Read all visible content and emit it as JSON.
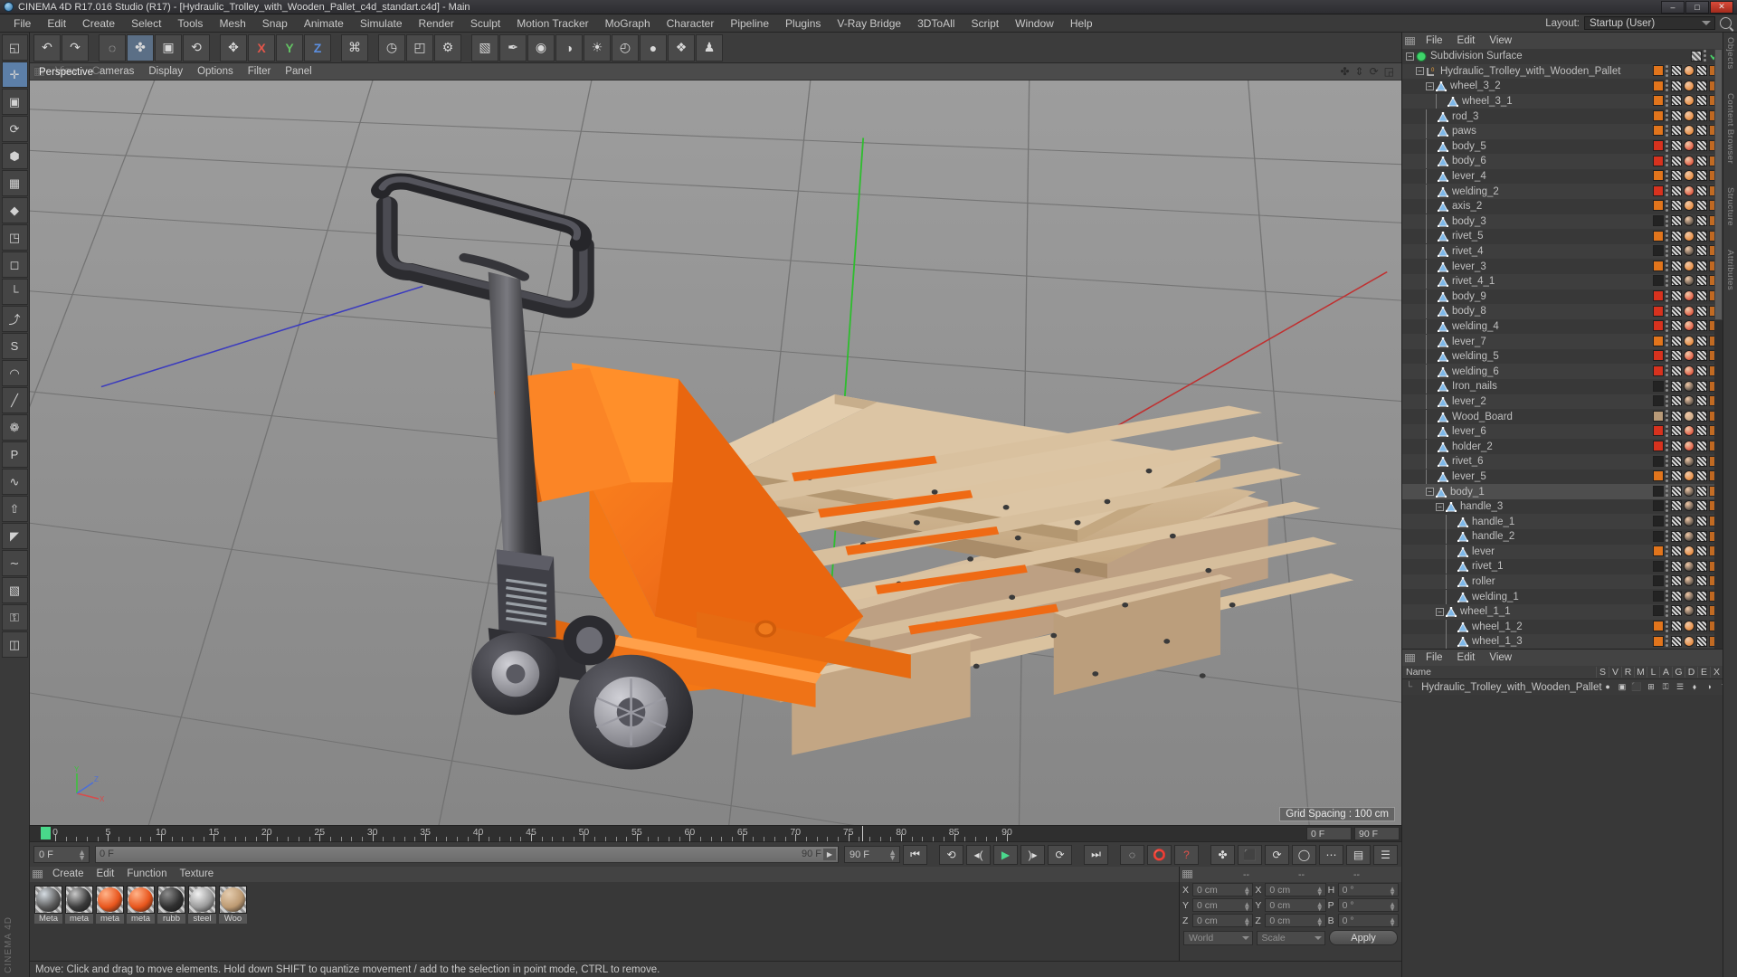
{
  "titlebar": {
    "text": "CINEMA 4D R17.016 Studio (R17) - [Hydraulic_Trolley_with_Wooden_Pallet_c4d_standart.c4d] - Main",
    "minimize": "–",
    "maximize": "□",
    "close": "✕"
  },
  "menubar": {
    "items": [
      "File",
      "Edit",
      "Create",
      "Select",
      "Tools",
      "Mesh",
      "Snap",
      "Animate",
      "Simulate",
      "Render",
      "Sculpt",
      "Motion Tracker",
      "MoGraph",
      "Character",
      "Pipeline",
      "Plugins",
      "V-Ray Bridge",
      "3DToAll",
      "Script",
      "Window",
      "Help"
    ],
    "layout_label": "Layout:",
    "layout_value": "Startup (User)"
  },
  "left_tools": [
    {
      "name": "live-selection-tool",
      "glyph": "◱"
    },
    {
      "name": "move-tool",
      "glyph": "✛"
    },
    {
      "name": "scale-tool",
      "glyph": "▣"
    },
    {
      "name": "rotate-tool",
      "glyph": "⟳"
    },
    {
      "name": "model-mode-tool",
      "glyph": "⬢"
    },
    {
      "name": "texture-mode-tool",
      "glyph": "▦"
    },
    {
      "name": "polygon-mode-tool",
      "glyph": "◆"
    },
    {
      "name": "edge-mode-tool",
      "glyph": "◳"
    },
    {
      "name": "point-mode-tool",
      "glyph": "◻"
    },
    {
      "name": "axis-lock-tool",
      "glyph": "└"
    },
    {
      "name": "enable-axis-tool",
      "glyph": "⤴"
    },
    {
      "name": "enable-snap-tool",
      "glyph": "S"
    },
    {
      "name": "magnet-tool",
      "glyph": "◠"
    },
    {
      "name": "knife-tool",
      "glyph": "╱"
    },
    {
      "name": "brush-tool",
      "glyph": "❁"
    },
    {
      "name": "paint-tool",
      "glyph": "P"
    },
    {
      "name": "smooth-tool",
      "glyph": "∿"
    },
    {
      "name": "extrude-tool",
      "glyph": "⇧"
    },
    {
      "name": "bevel-tool",
      "glyph": "◤"
    },
    {
      "name": "spline-tool",
      "glyph": "∼"
    },
    {
      "name": "uv-tool",
      "glyph": "▧"
    },
    {
      "name": "lock-tool",
      "glyph": "⚿"
    },
    {
      "name": "workplane-tool",
      "glyph": "◫"
    }
  ],
  "toolbar": [
    {
      "name": "undo-button",
      "glyph": "↶",
      "style": "orange"
    },
    {
      "name": "redo-button",
      "glyph": "↷",
      "style": "orange"
    },
    {
      "name": "live-selection-button",
      "glyph": "◌",
      "style": ""
    },
    {
      "name": "move-button",
      "glyph": "✤",
      "style": "on"
    },
    {
      "name": "scale-button",
      "glyph": "▣",
      "style": ""
    },
    {
      "name": "rotate-button",
      "glyph": "⟲",
      "style": ""
    },
    {
      "name": "world-axis-button",
      "glyph": "✥",
      "style": ""
    },
    {
      "name": "x-axis-button",
      "glyph": "X",
      "style": "red axis"
    },
    {
      "name": "y-axis-button",
      "glyph": "Y",
      "style": "green axis"
    },
    {
      "name": "z-axis-button",
      "glyph": "Z",
      "style": "blue axis"
    },
    {
      "name": "world-object-button",
      "glyph": "⌘",
      "style": ""
    },
    {
      "name": "render-view-button",
      "glyph": "◷",
      "style": ""
    },
    {
      "name": "render-region-button",
      "glyph": "◰",
      "style": ""
    },
    {
      "name": "render-settings-button",
      "glyph": "⚙",
      "style": ""
    },
    {
      "name": "cube-primitive-button",
      "glyph": "▧",
      "style": ""
    },
    {
      "name": "spline-pen-button",
      "glyph": "✒",
      "style": ""
    },
    {
      "name": "generator-button",
      "glyph": "◉",
      "style": ""
    },
    {
      "name": "deformer-button",
      "glyph": "◑",
      "style": ""
    },
    {
      "name": "environment-button",
      "glyph": "☀",
      "style": ""
    },
    {
      "name": "camera-button",
      "glyph": "◴",
      "style": ""
    },
    {
      "name": "light-button",
      "glyph": "●",
      "style": ""
    },
    {
      "name": "mograph-button",
      "glyph": "❖",
      "style": ""
    },
    {
      "name": "character-button",
      "glyph": "♟",
      "style": ""
    }
  ],
  "viewport": {
    "menus": [
      "View",
      "Cameras",
      "Display",
      "Options",
      "Filter",
      "Panel"
    ],
    "corner_icons": [
      "move-viewport-icon",
      "zoom-viewport-icon",
      "rotate-viewport-icon",
      "maximize-viewport-icon"
    ],
    "perspective_label": "Perspective",
    "grid_spacing_label": "Grid Spacing : 100 cm",
    "axis_labels": {
      "x": "X",
      "y": "Y",
      "z": "Z"
    }
  },
  "timeline": {
    "ticks": [
      0,
      5,
      10,
      15,
      20,
      25,
      30,
      35,
      40,
      45,
      50,
      55,
      60,
      65,
      70,
      75,
      80,
      85,
      90
    ],
    "current_frame_field": "0 F",
    "end_frame_field": "90 F",
    "slider_left_label": "0 F",
    "slider_right_label": "90 F",
    "preview_start": "0 F",
    "preview_end": "90 F"
  },
  "transport": {
    "buttons": [
      {
        "name": "go-to-start-button",
        "glyph": "⏮"
      },
      {
        "name": "play-backwards-button",
        "glyph": "⟲"
      },
      {
        "name": "previous-frame-button",
        "glyph": "◂("
      },
      {
        "name": "play-button",
        "glyph": "▶"
      },
      {
        "name": "next-frame-button",
        "glyph": ")▸"
      },
      {
        "name": "play-forwards-button",
        "glyph": "⟳"
      },
      {
        "name": "go-to-end-button",
        "glyph": "⏭"
      },
      {
        "name": "record-active-objects-button",
        "glyph": "◌"
      },
      {
        "name": "autokeying-button",
        "glyph": "⭕"
      },
      {
        "name": "keyframe-selection-button",
        "glyph": "?"
      },
      {
        "name": "position-key-button",
        "glyph": "✤"
      },
      {
        "name": "scale-key-button",
        "glyph": "⬛"
      },
      {
        "name": "rotation-key-button",
        "glyph": "⟳"
      },
      {
        "name": "parameter-key-button",
        "glyph": "◯"
      },
      {
        "name": "point-level-key-button",
        "glyph": "⋯"
      },
      {
        "name": "animation-mode-button",
        "glyph": "▤"
      },
      {
        "name": "timeline-toggle-button",
        "glyph": "☰"
      }
    ]
  },
  "materials": {
    "menu": [
      "Create",
      "Edit",
      "Function",
      "Texture"
    ],
    "items": [
      {
        "label": "Meta",
        "color": "#5c5c5c",
        "hi": "#d6dde3"
      },
      {
        "label": "meta",
        "color": "#3a3a3a",
        "hi": "#c9c9c9"
      },
      {
        "label": "meta",
        "color": "#e8551c",
        "hi": "#ffb48a"
      },
      {
        "label": "meta",
        "color": "#e8551c",
        "hi": "#ffb48a"
      },
      {
        "label": "rubb",
        "color": "#2f2f2f",
        "hi": "#8d8d8d"
      },
      {
        "label": "steel",
        "color": "#9b9b9b",
        "hi": "#f2f2f2"
      },
      {
        "label": "Woo",
        "color": "#bd9a72",
        "hi": "#e5cdb0"
      }
    ]
  },
  "coordinates": {
    "headers": [
      "--",
      "--",
      "--"
    ],
    "rows": [
      {
        "l1": "X",
        "v1": "0 cm",
        "l2": "X",
        "v2": "0 cm",
        "l3": "H",
        "v3": "0 °"
      },
      {
        "l1": "Y",
        "v1": "0 cm",
        "l2": "Y",
        "v2": "0 cm",
        "l3": "P",
        "v3": "0 °"
      },
      {
        "l1": "Z",
        "v1": "0 cm",
        "l2": "Z",
        "v2": "0 cm",
        "l3": "B",
        "v3": "0 °"
      }
    ],
    "space_select": "World",
    "mode_select": "Scale",
    "apply_label": "Apply"
  },
  "statusbar": {
    "text": "Move: Click and drag to move elements. Hold down SHIFT to quantize movement / add to the selection in point mode, CTRL to remove."
  },
  "object_manager": {
    "menu": [
      "File",
      "Edit",
      "View"
    ],
    "rows": [
      {
        "label": "Subdivision Surface",
        "depth": 0,
        "icon": "subdivision",
        "exp": "-",
        "tag": "checker",
        "check": true
      },
      {
        "label": "Hydraulic_Trolley_with_Wooden_Pallet",
        "depth": 1,
        "icon": "null",
        "exp": "-",
        "tag": "orange"
      },
      {
        "label": "wheel_3_2",
        "depth": 2,
        "icon": "mesh",
        "exp": "-",
        "tag": "orange"
      },
      {
        "label": "wheel_3_1",
        "depth": 3,
        "icon": "mesh",
        "exp": "L",
        "tag": "orange"
      },
      {
        "label": "rod_3",
        "depth": 2,
        "icon": "mesh",
        "exp": "T",
        "tag": "orange"
      },
      {
        "label": "paws",
        "depth": 2,
        "icon": "mesh",
        "exp": "T",
        "tag": "orange"
      },
      {
        "label": "body_5",
        "depth": 2,
        "icon": "mesh",
        "exp": "T",
        "tag": "red"
      },
      {
        "label": "body_6",
        "depth": 2,
        "icon": "mesh",
        "exp": "T",
        "tag": "red"
      },
      {
        "label": "lever_4",
        "depth": 2,
        "icon": "mesh",
        "exp": "T",
        "tag": "orange"
      },
      {
        "label": "welding_2",
        "depth": 2,
        "icon": "mesh",
        "exp": "T",
        "tag": "red"
      },
      {
        "label": "axis_2",
        "depth": 2,
        "icon": "mesh",
        "exp": "T",
        "tag": "orange"
      },
      {
        "label": "body_3",
        "depth": 2,
        "icon": "mesh",
        "exp": "T",
        "tag": "dark"
      },
      {
        "label": "rivet_5",
        "depth": 2,
        "icon": "mesh",
        "exp": "T",
        "tag": "orange"
      },
      {
        "label": "rivet_4",
        "depth": 2,
        "icon": "mesh",
        "exp": "T",
        "tag": "dark"
      },
      {
        "label": "lever_3",
        "depth": 2,
        "icon": "mesh",
        "exp": "T",
        "tag": "orange"
      },
      {
        "label": "rivet_4_1",
        "depth": 2,
        "icon": "mesh",
        "exp": "T",
        "tag": "dark"
      },
      {
        "label": "body_9",
        "depth": 2,
        "icon": "mesh",
        "exp": "T",
        "tag": "red"
      },
      {
        "label": "body_8",
        "depth": 2,
        "icon": "mesh",
        "exp": "T",
        "tag": "red"
      },
      {
        "label": "welding_4",
        "depth": 2,
        "icon": "mesh",
        "exp": "T",
        "tag": "red"
      },
      {
        "label": "lever_7",
        "depth": 2,
        "icon": "mesh",
        "exp": "T",
        "tag": "orange"
      },
      {
        "label": "welding_5",
        "depth": 2,
        "icon": "mesh",
        "exp": "T",
        "tag": "red"
      },
      {
        "label": "welding_6",
        "depth": 2,
        "icon": "mesh",
        "exp": "T",
        "tag": "red"
      },
      {
        "label": "Iron_nails",
        "depth": 2,
        "icon": "mesh",
        "exp": "T",
        "tag": "dark"
      },
      {
        "label": "lever_2",
        "depth": 2,
        "icon": "mesh",
        "exp": "T",
        "tag": "dark"
      },
      {
        "label": "Wood_Board",
        "depth": 2,
        "icon": "mesh",
        "exp": "T",
        "tag": "wood"
      },
      {
        "label": "lever_6",
        "depth": 2,
        "icon": "mesh",
        "exp": "T",
        "tag": "red"
      },
      {
        "label": "holder_2",
        "depth": 2,
        "icon": "mesh",
        "exp": "T",
        "tag": "red"
      },
      {
        "label": "rivet_6",
        "depth": 2,
        "icon": "mesh",
        "exp": "T",
        "tag": "dark"
      },
      {
        "label": "lever_5",
        "depth": 2,
        "icon": "mesh",
        "exp": "T",
        "tag": "orange"
      },
      {
        "label": "body_1",
        "depth": 2,
        "icon": "mesh",
        "exp": "-",
        "tag": "dark",
        "selected": true
      },
      {
        "label": "handle_3",
        "depth": 3,
        "icon": "mesh",
        "exp": "-",
        "tag": "dark"
      },
      {
        "label": "handle_1",
        "depth": 4,
        "icon": "mesh",
        "exp": "T",
        "tag": "dark"
      },
      {
        "label": "handle_2",
        "depth": 4,
        "icon": "mesh",
        "exp": "T",
        "tag": "dark"
      },
      {
        "label": "lever",
        "depth": 4,
        "icon": "mesh",
        "exp": "T",
        "tag": "orange"
      },
      {
        "label": "rivet_1",
        "depth": 4,
        "icon": "mesh",
        "exp": "T",
        "tag": "dark"
      },
      {
        "label": "roller",
        "depth": 4,
        "icon": "mesh",
        "exp": "T",
        "tag": "dark"
      },
      {
        "label": "welding_1",
        "depth": 4,
        "icon": "mesh",
        "exp": "T",
        "tag": "dark"
      },
      {
        "label": "wheel_1_1",
        "depth": 3,
        "icon": "mesh",
        "exp": "-",
        "tag": "dark"
      },
      {
        "label": "wheel_1_2",
        "depth": 4,
        "icon": "mesh",
        "exp": "T",
        "tag": "orange"
      },
      {
        "label": "wheel_1_3",
        "depth": 4,
        "icon": "mesh",
        "exp": "T",
        "tag": "orange"
      }
    ]
  },
  "layer_manager": {
    "menu": [
      "File",
      "Edit",
      "View"
    ],
    "columns": [
      "Name",
      "S",
      "V",
      "R",
      "M",
      "L",
      "A",
      "G",
      "D",
      "E",
      "X"
    ],
    "rows": [
      {
        "label": "Hydraulic_Trolley_with_Wooden_Pallet",
        "color": "#e2751c",
        "icons": [
          "●",
          "▣",
          "⬛",
          "⊞",
          "⚿",
          "☰",
          "⬧",
          "◑",
          "◝",
          "❖"
        ]
      }
    ]
  },
  "right_tabs": [
    "Objects",
    "Content Browser",
    "Structure",
    "Attributes"
  ]
}
